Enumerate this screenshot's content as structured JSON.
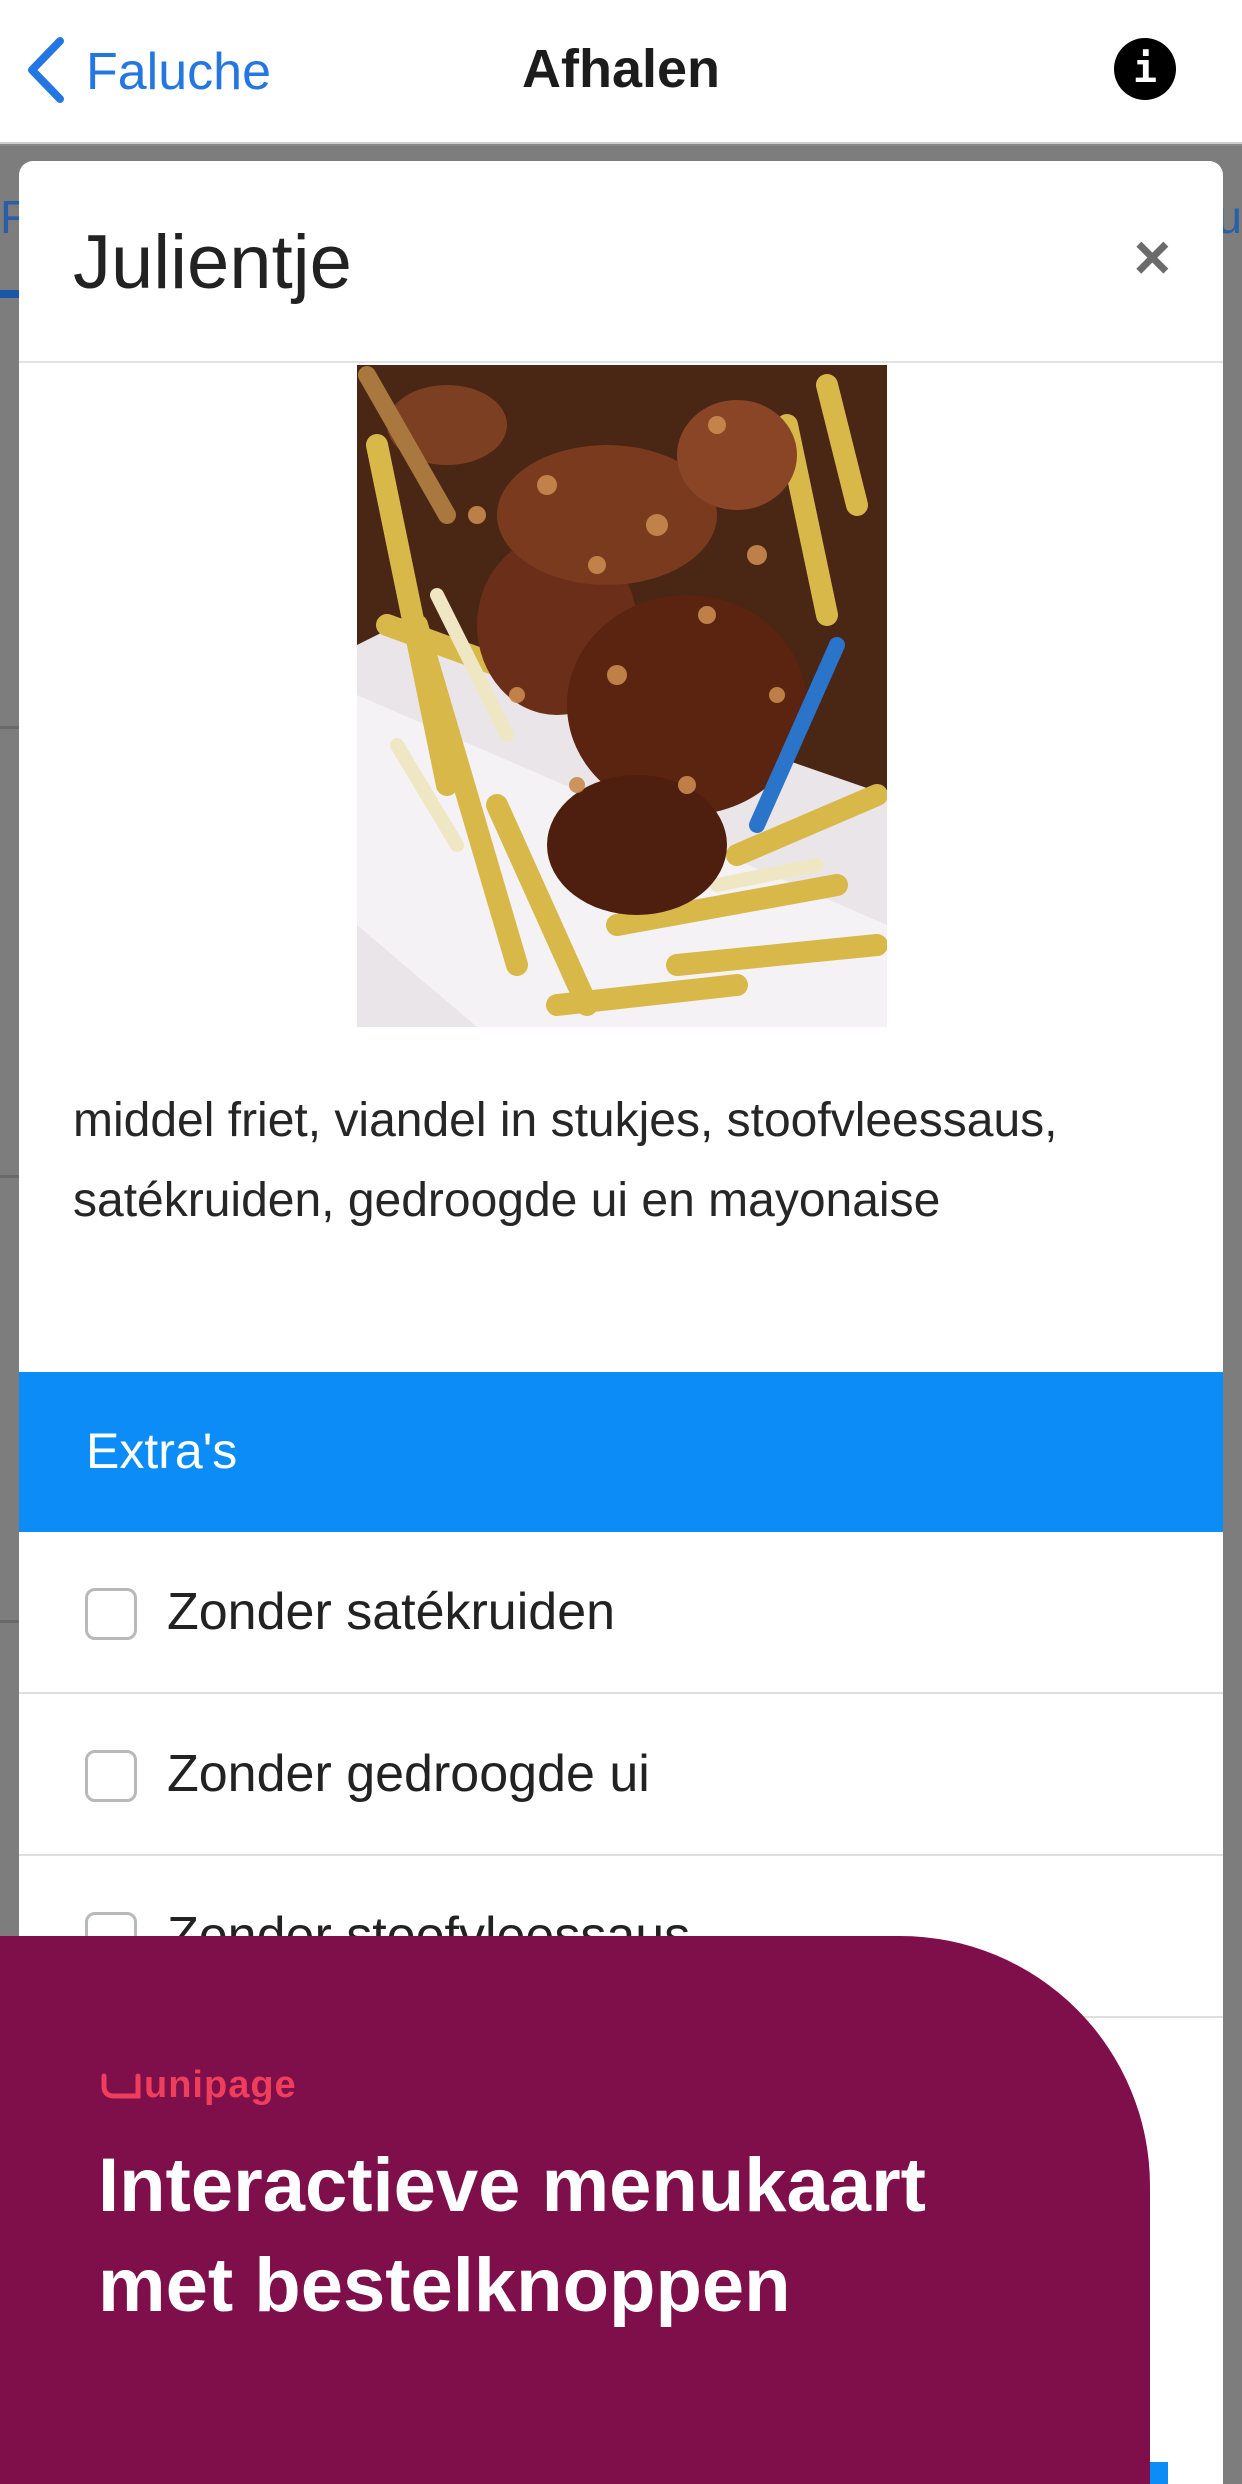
{
  "navbar": {
    "back_label": "Faluche",
    "title": "Afhalen",
    "info_glyph": "i"
  },
  "background_page": {
    "tab_left_fragment": "F",
    "tab_right_fragment": "u"
  },
  "modal": {
    "title": "Julientje",
    "close_glyph": "×",
    "description": "middel friet, viandel in stukjes, stoofvleessaus, satékruiden, gedroogde ui en mayonaise",
    "extras_title": "Extra's",
    "options": [
      {
        "label": "Zonder satékruiden",
        "checked": false
      },
      {
        "label": "Zonder gedroogde ui",
        "checked": false
      },
      {
        "label": "Zonder stoofvleessaus",
        "checked": false
      }
    ]
  },
  "promo": {
    "logo_text": "unipage",
    "heading_line1": "Interactieve menukaart",
    "heading_line2": "met bestelknoppen"
  },
  "colors": {
    "accent_blue": "#0b8cf7",
    "ios_link_blue": "#2477e2",
    "promo_background": "#7f0f4a",
    "promo_logo": "#ef3d5c"
  },
  "icons": {
    "back": "chevron-left-icon",
    "info": "info-icon",
    "close": "close-icon",
    "logo": "unipage-logo"
  }
}
